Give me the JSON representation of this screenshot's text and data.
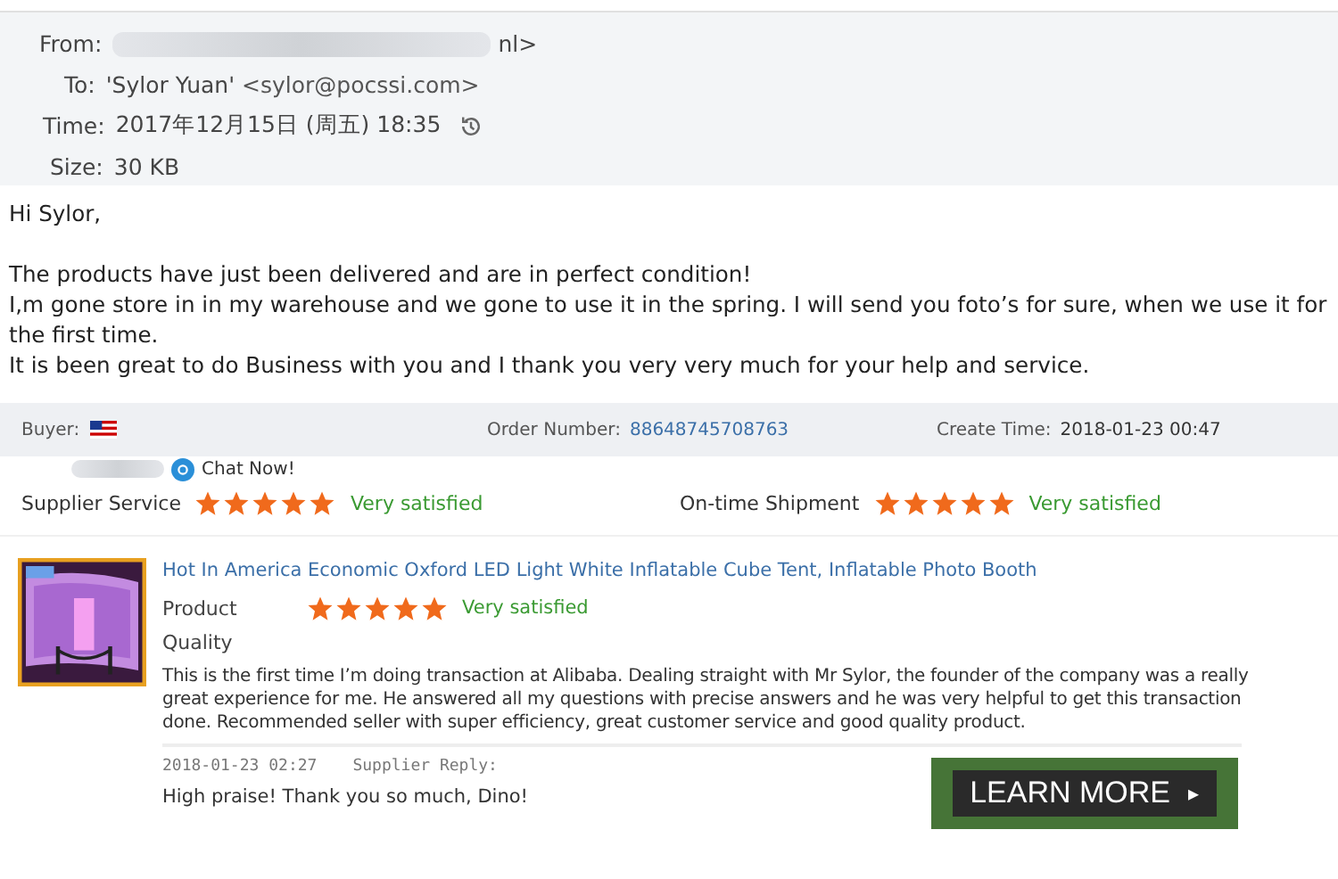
{
  "email": {
    "from_label": "From:",
    "from_value": "nl>",
    "to_label": "To:",
    "to_value": "'Sylor Yuan'",
    "to_address": "<sylor@pocssi.com>",
    "time_label": "Time:",
    "time_value": "2017年12月15日 (周五) 18:35",
    "size_label": "Size:",
    "size_value": "30 KB",
    "greeting": "Hi Sylor,",
    "body": [
      "The products have just been delivered and are in perfect condition!",
      "I,m gone store in in my warehouse and we gone to use it in the spring. I will send you foto’s for sure,  when we use it for the first time.",
      "It is been great to do Business with you and I thank you very very much for your help and service."
    ]
  },
  "order": {
    "buyer_label": "Buyer:",
    "order_label": "Order Number:",
    "order_number": "88648745708763",
    "create_label": "Create Time:",
    "create_time": "2018-01-23 00:47",
    "chat": "Chat Now!"
  },
  "ratings": [
    {
      "label": "Supplier Service",
      "stars": 5,
      "verdict": "Very satisfied"
    },
    {
      "label": "On-time Shipment",
      "stars": 5,
      "verdict": "Very satisfied"
    }
  ],
  "product": {
    "kind": "picture",
    "title": "Hot In America Economic Oxford LED Light White Inflatable Cube Tent, Inflatable Photo Booth",
    "rating_label": "Product",
    "rating_label_2": "Quality",
    "stars": 5,
    "verdict": "Very satisfied",
    "review": "This is the first time I’m doing transaction at Alibaba. Dealing straight with Mr Sylor, the founder of the company was a really great experience for me. He answered all my questions with precise answers and he was very helpful to get this transaction done. Recommended seller with super efficiency, great customer service and good quality product.",
    "reply_time": "2018-01-23 02:27",
    "reply_label": "Supplier Reply:",
    "reply": "High praise! Thank you so much, Dino!"
  },
  "cta": {
    "label": "LEARN MORE",
    "arrow": "▸"
  }
}
